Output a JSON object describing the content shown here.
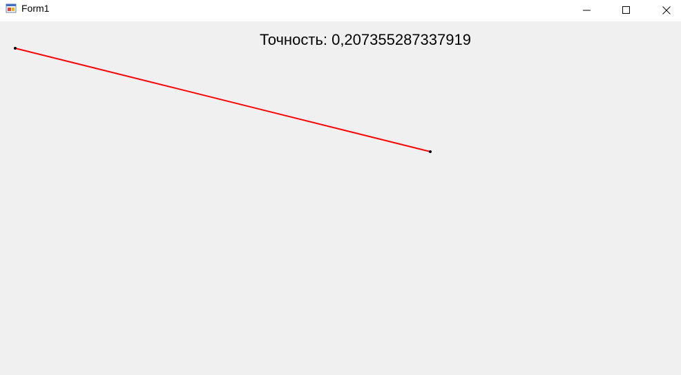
{
  "window": {
    "title": "Form1",
    "controls": {
      "minimize_icon": "minimize-icon",
      "maximize_icon": "maximize-icon",
      "close_icon": "close-icon"
    }
  },
  "content": {
    "accuracy_text": "Точность: 0,207355287337919",
    "line_color": "#ff0000",
    "point_color": "#000000"
  }
}
